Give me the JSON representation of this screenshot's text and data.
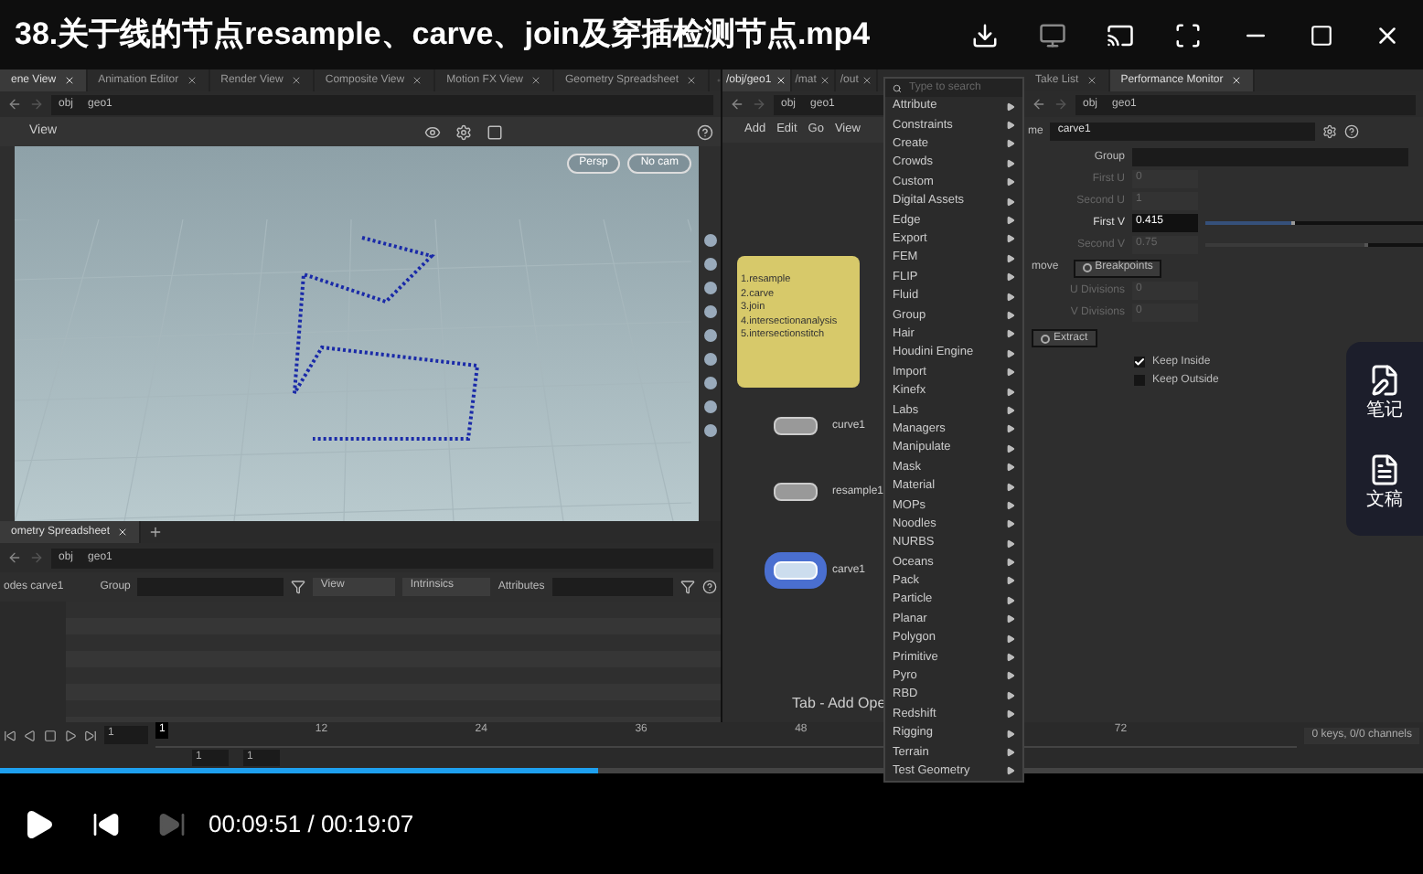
{
  "title_bar": {
    "title": "38.关于线的节点resample、carve、join及穿插检测节点.mp4"
  },
  "scene_panel": {
    "tabs": [
      {
        "label": "ene View",
        "selected": true
      },
      {
        "label": "Animation Editor",
        "selected": false
      },
      {
        "label": "Render View",
        "selected": false
      },
      {
        "label": "Composite View",
        "selected": false
      },
      {
        "label": "Motion FX View",
        "selected": false
      },
      {
        "label": "Geometry Spreadsheet",
        "selected": false
      }
    ],
    "path": [
      "obj",
      "geo1"
    ],
    "view_label": "View",
    "camera_buttons": [
      "Persp",
      "No cam"
    ]
  },
  "spreadsheet": {
    "tab": "ometry Spreadsheet",
    "path": [
      "obj",
      "geo1"
    ],
    "node": "odes carve1",
    "group_label": "Group",
    "view_menu": "View",
    "intrinsics_menu": "Intrinsics",
    "attributes_label": "Attributes"
  },
  "network": {
    "tabs": [
      {
        "label": "/obj/geo1",
        "selected": true
      },
      {
        "label": "/mat",
        "selected": false
      },
      {
        "label": "/out",
        "selected": false
      }
    ],
    "path": [
      "obj",
      "geo1"
    ],
    "menu": [
      "Add",
      "Edit",
      "Go",
      "View"
    ],
    "sticky_note": [
      "1.resample",
      "2.carve",
      "3.join",
      "4.intersectionanalysis",
      "5.intersectionstitch"
    ],
    "nodes": [
      {
        "name": "curve1",
        "selected": false
      },
      {
        "name": "resample1",
        "selected": false
      },
      {
        "name": "carve1",
        "selected": true
      }
    ],
    "hint": "Tab - Add Ope"
  },
  "tab_menu": {
    "placeholder": "Type to search",
    "items": [
      "Attribute",
      "Constraints",
      "Create",
      "Crowds",
      "Custom",
      "Digital Assets",
      "Edge",
      "Export",
      "FEM",
      "FLIP",
      "Fluid",
      "Group",
      "Hair",
      "Houdini Engine",
      "Import",
      "Kinefx",
      "Labs",
      "Managers",
      "Manipulate",
      "Mask",
      "Material",
      "MOPs",
      "Noodles",
      "NURBS",
      "Oceans",
      "Pack",
      "Particle",
      "Planar",
      "Polygon",
      "Primitive",
      "Pyro",
      "RBD",
      "Redshift",
      "Rigging",
      "Terrain",
      "Test Geometry"
    ]
  },
  "parameters": {
    "tabs": [
      {
        "label": "Take List",
        "selected": false
      },
      {
        "label": "Performance Monitor",
        "selected": true
      }
    ],
    "path": [
      "obj",
      "geo1"
    ],
    "name_label": "me",
    "node_name": "carve1",
    "group_label": "Group",
    "fields": [
      {
        "label": "First U",
        "value": "0",
        "disabled": true
      },
      {
        "label": "Second U",
        "value": "1",
        "disabled": true
      },
      {
        "label": "First V",
        "value": "0.415",
        "disabled": false,
        "level": 0.415
      },
      {
        "label": "Second V",
        "value": "0.75",
        "disabled": true,
        "level": 0.75
      }
    ],
    "buttons": [
      {
        "label": "move",
        "selected": false
      },
      {
        "label": "Breakpoints",
        "selected": true
      }
    ],
    "divisions": [
      {
        "label": "U Divisions",
        "value": "0"
      },
      {
        "label": "V Divisions",
        "value": "0"
      }
    ],
    "extract_button": "Extract",
    "checkboxes": [
      {
        "label": "Keep Inside",
        "checked": true
      },
      {
        "label": "Keep Outside",
        "checked": false
      }
    ]
  },
  "timeline": {
    "frame": "1",
    "start_marker": "1",
    "ticks": [
      "12",
      "24",
      "36",
      "48",
      "72"
    ],
    "range": [
      "1",
      "1"
    ],
    "keys": "0 keys, 0/0 channels"
  },
  "player": {
    "level": 0.42,
    "time": "00:09:51 / 00:19:07"
  },
  "side_panel": [
    {
      "kind": "notes",
      "label": "笔记"
    },
    {
      "kind": "draft",
      "label": "文稿"
    }
  ]
}
